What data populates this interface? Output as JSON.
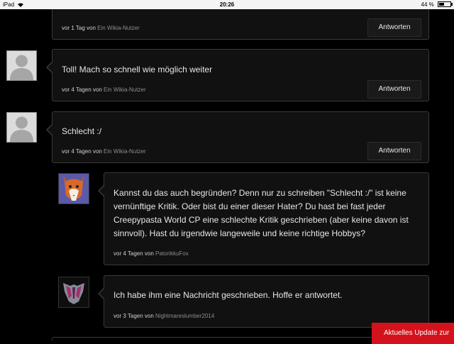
{
  "status_bar": {
    "device": "iPad",
    "time": "20:26",
    "battery": "44 %",
    "battery_level": 0.44
  },
  "reply_label": "Antworten",
  "meta_prefix": "von",
  "comments": [
    {
      "time": "vor 1 Tag",
      "user": "Ein Wikia-Nutzer"
    },
    {
      "text": "Toll! Mach so schnell wie möglich weiter",
      "time": "vor 4 Tagen",
      "user": "Ein Wikia-Nutzer",
      "avatar": "default-avatar-icon"
    },
    {
      "text": "Schlecht :/",
      "time": "vor 4 Tagen",
      "user": "Ein Wikia-Nutzer",
      "avatar": "default-avatar-icon"
    }
  ],
  "replies": [
    {
      "text": "Kannst du das auch begründen? Denn nur zu schreiben \"Schlecht :/\" ist keine vernünftige Kritik. Oder bist du einer dieser Hater? Du hast bei fast jeder Creepypasta World CP eine schlechte Kritik geschrieben (aber keine davon ist sinnvoll). Hast du irgendwie langeweile und keine richtige Hobbys?",
      "time": "vor 4 Tagen",
      "user": "PatorikkuFox",
      "avatar": "fox-avatar"
    },
    {
      "text": "Ich habe ihm eine Nachricht geschrieben. Hoffe er antwortet.",
      "time": "vor 3 Tagen",
      "user": "Nightmareslumber2014",
      "avatar": "decepticon-avatar"
    }
  ],
  "toast": {
    "text": "Aktuelles Update zur"
  }
}
